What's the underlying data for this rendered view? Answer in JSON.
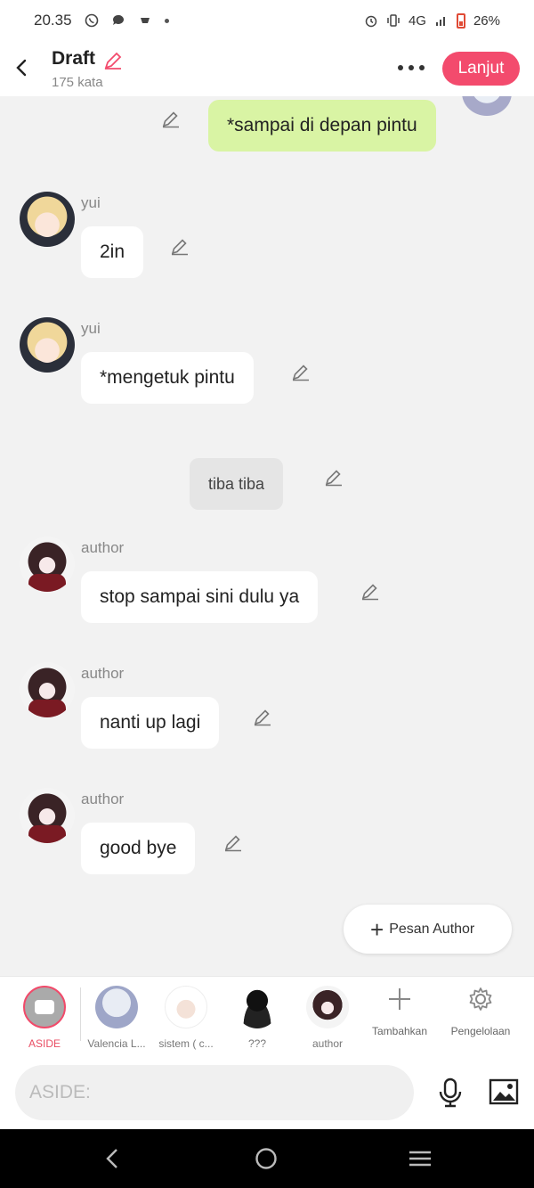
{
  "status": {
    "time": "20.35",
    "network": "4G",
    "battery": "26%"
  },
  "header": {
    "title": "Draft",
    "word_count": "175 kata",
    "next_label": "Lanjut"
  },
  "messages": [
    {
      "type": "me",
      "text": "*sampai di depan pintu"
    },
    {
      "type": "char",
      "sender": "yui",
      "text": "2in"
    },
    {
      "type": "char",
      "sender": "yui",
      "text": "*mengetuk pintu"
    },
    {
      "type": "aside",
      "text": "tiba tiba"
    },
    {
      "type": "char",
      "sender": "author",
      "text": "stop sampai sini dulu ya"
    },
    {
      "type": "char",
      "sender": "author",
      "text": "nanti up lagi"
    },
    {
      "type": "char",
      "sender": "author",
      "text": "good bye"
    }
  ],
  "fab": {
    "label": "Pesan Author"
  },
  "characters": [
    {
      "label": "ASIDE"
    },
    {
      "label": "Valencia L..."
    },
    {
      "label": "sistem ( c..."
    },
    {
      "label": "???"
    },
    {
      "label": "author"
    }
  ],
  "tools": {
    "add_label": "Tambahkan",
    "manage_label": "Pengelolaan"
  },
  "input": {
    "placeholder": "ASIDE:"
  },
  "colors": {
    "accent": "#f34b6d",
    "my_bubble": "#d9f4a4",
    "background": "#f2f2f2"
  }
}
